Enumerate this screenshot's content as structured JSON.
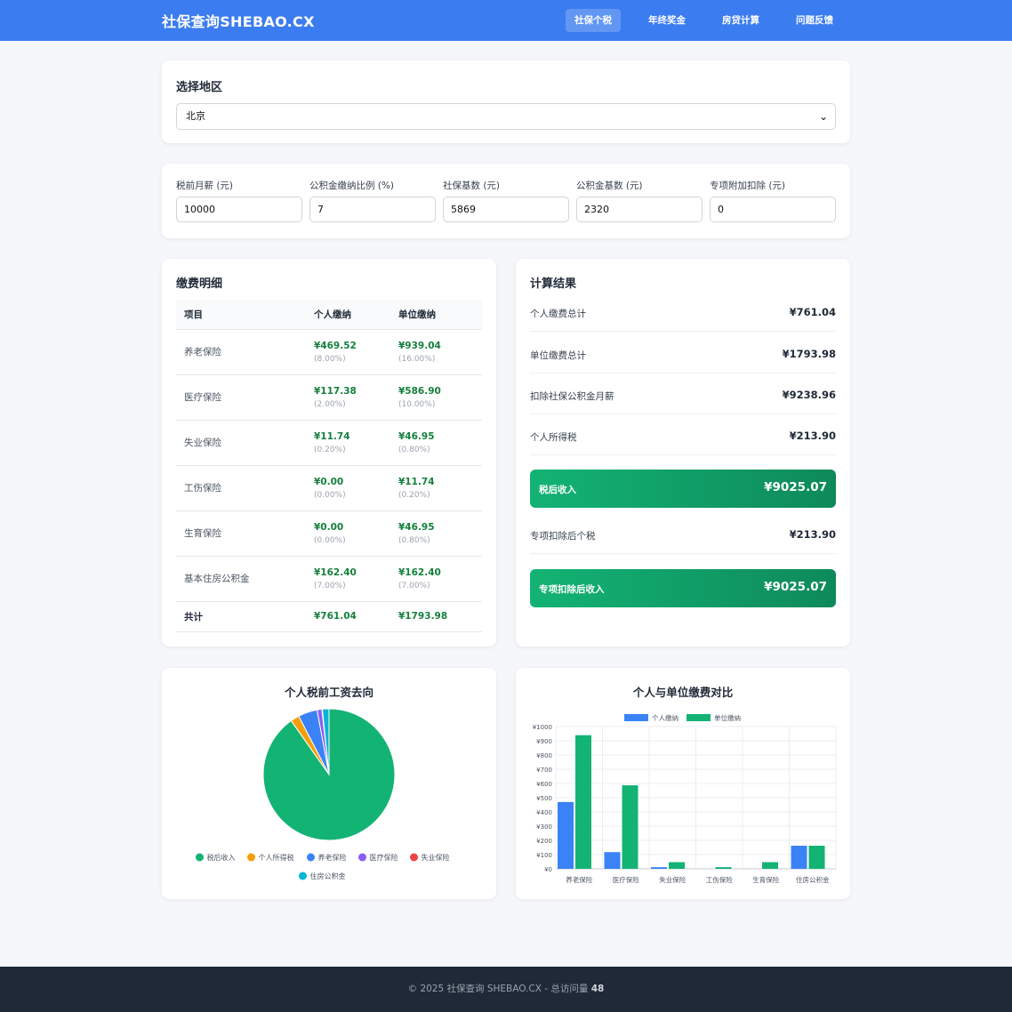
{
  "nav": {
    "brand": "社保查询SHEBAO.CX",
    "links": [
      "社保个税",
      "年终奖金",
      "房贷计算",
      "问题反馈"
    ]
  },
  "region": {
    "title": "选择地区",
    "selected": "北京"
  },
  "inputs": [
    {
      "label": "税前月薪 (元)",
      "value": "10000"
    },
    {
      "label": "公积金缴纳比例 (%)",
      "value": "7"
    },
    {
      "label": "社保基数 (元)",
      "value": "5869"
    },
    {
      "label": "公积金基数 (元)",
      "value": "2320"
    },
    {
      "label": "专项附加扣除 (元)",
      "value": "0"
    }
  ],
  "detail": {
    "title": "缴费明细",
    "headers": [
      "项目",
      "个人缴纳",
      "单位缴纳"
    ],
    "rows": [
      {
        "item": "养老保险",
        "personal": "¥469.52",
        "personal_pct": "(8.00%)",
        "company": "¥939.04",
        "company_pct": "(16.00%)"
      },
      {
        "item": "医疗保险",
        "personal": "¥117.38",
        "personal_pct": "(2.00%)",
        "company": "¥586.90",
        "company_pct": "(10.00%)"
      },
      {
        "item": "失业保险",
        "personal": "¥11.74",
        "personal_pct": "(0.20%)",
        "company": "¥46.95",
        "company_pct": "(0.80%)"
      },
      {
        "item": "工伤保险",
        "personal": "¥0.00",
        "personal_pct": "(0.00%)",
        "company": "¥11.74",
        "company_pct": "(0.20%)"
      },
      {
        "item": "生育保险",
        "personal": "¥0.00",
        "personal_pct": "(0.00%)",
        "company": "¥46.95",
        "company_pct": "(0.80%)"
      },
      {
        "item": "基本住房公积金",
        "personal": "¥162.40",
        "personal_pct": "(7.00%)",
        "company": "¥162.40",
        "company_pct": "(7.00%)"
      }
    ],
    "total": {
      "item": "共计",
      "personal": "¥761.04",
      "company": "¥1793.98"
    }
  },
  "result": {
    "title": "计算结果",
    "rows": [
      {
        "label": "个人缴费总计",
        "value": "¥761.04"
      },
      {
        "label": "单位缴费总计",
        "value": "¥1793.98"
      },
      {
        "label": "扣除社保公积金月薪",
        "value": "¥9238.96"
      },
      {
        "label": "个人所得税",
        "value": "¥213.90"
      }
    ],
    "after_tax": {
      "label": "税后收入",
      "value": "¥9025.07"
    },
    "special_tax": {
      "label": "专项扣除后个税",
      "value": "¥213.90"
    },
    "special_income": {
      "label": "专项扣除后收入",
      "value": "¥9025.07"
    }
  },
  "chart_data": [
    {
      "type": "pie",
      "title": "个人税前工资去向",
      "categories": [
        "税后收入",
        "个人所得税",
        "养老保险",
        "医疗保险",
        "失业保险",
        "住房公积金"
      ],
      "values": [
        9025.07,
        213.9,
        469.52,
        117.38,
        11.74,
        162.4
      ],
      "colors": [
        "#13b374",
        "#f59e0b",
        "#3b82f6",
        "#8b5cf6",
        "#ef4444",
        "#06b6d4"
      ],
      "legend": "bottom"
    },
    {
      "type": "bar",
      "title": "个人与单位缴费对比",
      "categories": [
        "养老保险",
        "医疗保险",
        "失业保险",
        "工伤保险",
        "生育保险",
        "住房公积金"
      ],
      "series": [
        {
          "name": "个人缴纳",
          "values": [
            469.52,
            117.38,
            11.74,
            0,
            0,
            162.4
          ],
          "color": "#3b82f6"
        },
        {
          "name": "单位缴纳",
          "values": [
            939.04,
            586.9,
            46.95,
            11.74,
            46.95,
            162.4
          ],
          "color": "#13b374"
        }
      ],
      "ylim": [
        0,
        1000
      ],
      "yticks": [
        "¥0",
        "¥100",
        "¥200",
        "¥300",
        "¥400",
        "¥500",
        "¥600",
        "¥700",
        "¥800",
        "¥900",
        "¥1000"
      ],
      "grid": true,
      "legend": "top"
    }
  ],
  "footer": {
    "text": "© 2025 社保查询 SHEBAO.CX - 总访问量",
    "count": "48"
  }
}
